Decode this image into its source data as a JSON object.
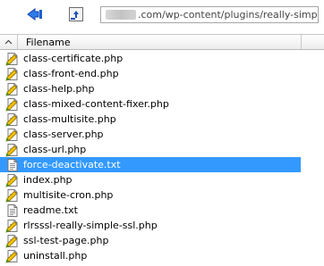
{
  "toolbar": {
    "back_icon": "back-arrow-icon",
    "up_icon": "parent-folder-icon",
    "path_suffix": ".com/wp-content/plugins/really-simple-ssl/"
  },
  "header": {
    "sort_indicator": "^",
    "filename_label": "Filename"
  },
  "colors": {
    "selection": "#3399ff",
    "php_pencil": "#f2c100",
    "php_accent": "#3a9a2a"
  },
  "files": [
    {
      "name": "class-certificate.php",
      "type": "php",
      "selected": false
    },
    {
      "name": "class-front-end.php",
      "type": "php",
      "selected": false
    },
    {
      "name": "class-help.php",
      "type": "php",
      "selected": false
    },
    {
      "name": "class-mixed-content-fixer.php",
      "type": "php",
      "selected": false
    },
    {
      "name": "class-multisite.php",
      "type": "php",
      "selected": false
    },
    {
      "name": "class-server.php",
      "type": "php",
      "selected": false
    },
    {
      "name": "class-url.php",
      "type": "php",
      "selected": false
    },
    {
      "name": "force-deactivate.txt",
      "type": "txt",
      "selected": true
    },
    {
      "name": "index.php",
      "type": "php",
      "selected": false
    },
    {
      "name": "multisite-cron.php",
      "type": "php",
      "selected": false
    },
    {
      "name": "readme.txt",
      "type": "txt",
      "selected": false
    },
    {
      "name": "rlrsssl-really-simple-ssl.php",
      "type": "php",
      "selected": false
    },
    {
      "name": "ssl-test-page.php",
      "type": "php",
      "selected": false
    },
    {
      "name": "uninstall.php",
      "type": "php",
      "selected": false
    }
  ]
}
